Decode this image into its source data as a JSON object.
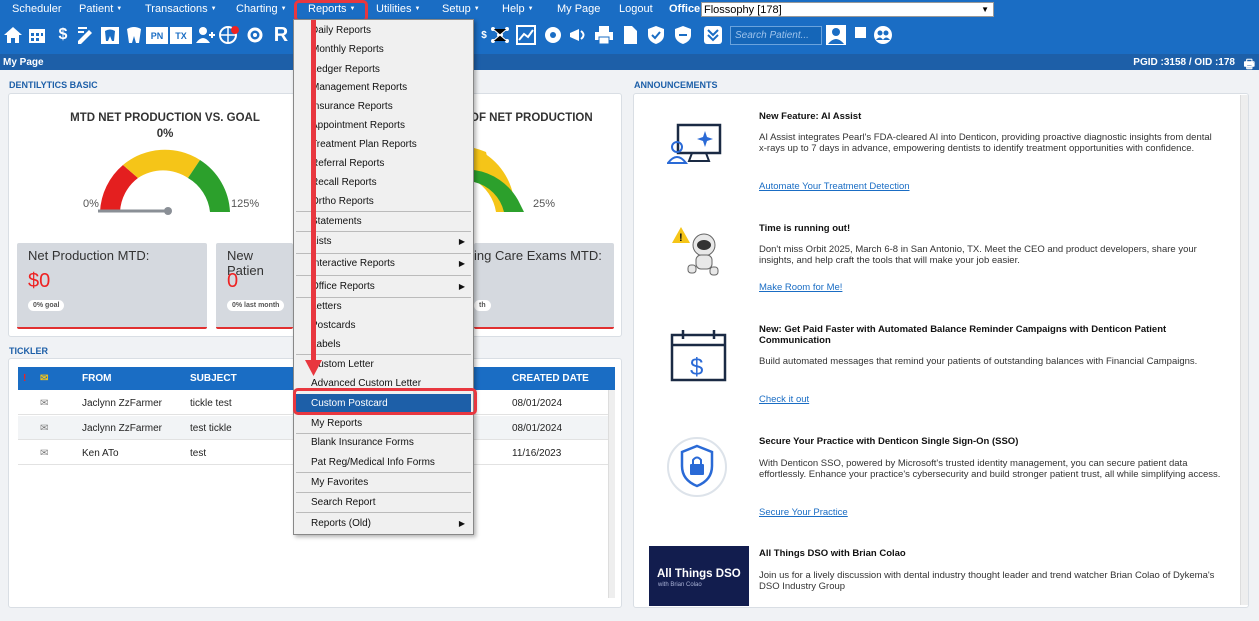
{
  "nav": {
    "items": [
      {
        "label": "Scheduler",
        "caret": false
      },
      {
        "label": "Patient",
        "caret": true
      },
      {
        "label": "Transactions",
        "caret": true
      },
      {
        "label": "Charting",
        "caret": true
      },
      {
        "label": "Reports",
        "caret": true
      },
      {
        "label": "Utilities",
        "caret": true
      },
      {
        "label": "Setup",
        "caret": true
      },
      {
        "label": "Help",
        "caret": true
      },
      {
        "label": "My Page",
        "caret": false
      },
      {
        "label": "Logout",
        "caret": false
      }
    ],
    "office_label": "Office",
    "office_value": "Flossophy [178]"
  },
  "toolbar": {
    "search_placeholder": "Search Patient..."
  },
  "subbar": {
    "title": "My Page",
    "ids": "PGID :3158  /  OID :178"
  },
  "dentilytics": {
    "section_title": "DENTILYTICS BASIC",
    "gauge1": {
      "title": "MTD NET PRODUCTION VS. GOAL",
      "value": "0%",
      "min": "0%",
      "max": "125%"
    },
    "gauge2": {
      "title": "OF NET PRODUCTION",
      "max": "25%"
    },
    "kpis": [
      {
        "title": "Net Production MTD:",
        "value": "$0",
        "badge": "0% goal"
      },
      {
        "title": "New Patien",
        "value": "0",
        "badge": "0% last month"
      },
      {
        "title": "ing Care Exams MTD:",
        "value": "",
        "badge": "th"
      }
    ]
  },
  "tickler": {
    "section_title": "TICKLER",
    "headers": {
      "flag": "!",
      "from": "FROM",
      "subject": "SUBJECT",
      "created": "CREATED DATE"
    },
    "rows": [
      {
        "from": "Jaclynn ZzFarmer",
        "subject": "tickle test",
        "created": "08/01/2024"
      },
      {
        "from": "Jaclynn ZzFarmer",
        "subject": "test tickle",
        "created": "08/01/2024"
      },
      {
        "from": "Ken ATo",
        "subject": "test",
        "created": "11/16/2023"
      }
    ]
  },
  "announcements": {
    "section_title": "ANNOUNCEMENTS",
    "items": [
      {
        "title": "New Feature: AI Assist",
        "body": "AI Assist integrates Pearl's FDA-cleared AI into Denticon, providing proactive diagnostic insights from dental x-rays up to 7 days in advance, empowering dentists to identify treatment opportunities with confidence.",
        "link": "Automate Your Treatment Detection"
      },
      {
        "title": "Time is running out!",
        "body": "Don't miss Orbit 2025, March 6-8 in San Antonio, TX. Meet the CEO and product developers, share your insights, and help craft the tools that will make your job easier.",
        "link": "Make Room for Me!"
      },
      {
        "title": "New: Get Paid Faster with Automated Balance Reminder Campaigns with Denticon Patient Communication",
        "body": "Build automated messages that remind your patients of outstanding balances with Financial Campaigns.",
        "link": "Check it out"
      },
      {
        "title": "Secure Your Practice with Denticon Single Sign-On (SSO)",
        "body": "With Denticon SSO, powered by Microsoft's trusted identity management, you can secure patient data effortlessly. Enhance your practice's cybersecurity and build stronger patient trust, all while simplifying access.",
        "link": "Secure Your Practice"
      },
      {
        "title": "All Things DSO with Brian Colao",
        "body": "Join us for a lively discussion with dental industry thought leader and trend watcher Brian Colao of Dykema's DSO Industry Group",
        "link": ""
      }
    ],
    "dso_thumb": {
      "title": "All Things DSO",
      "sub": "with Brian Colao"
    }
  },
  "reports_menu": {
    "items": [
      {
        "label": "Daily Reports",
        "sub": false
      },
      {
        "label": "Monthly Reports",
        "sub": false
      },
      {
        "label": "Ledger Reports",
        "sub": false
      },
      {
        "label": "Management Reports",
        "sub": false
      },
      {
        "label": "Insurance Reports",
        "sub": false
      },
      {
        "label": "Appointment Reports",
        "sub": false
      },
      {
        "label": "Treatment Plan Reports",
        "sub": false
      },
      {
        "label": "Referral Reports",
        "sub": false
      },
      {
        "label": "Recall Reports",
        "sub": false
      },
      {
        "label": "Ortho Reports",
        "sub": false
      },
      {
        "label": "Statements",
        "sub": false
      },
      {
        "label": "Lists",
        "sub": true
      },
      {
        "label": "Interactive Reports",
        "sub": true
      },
      {
        "label": "Office Reports",
        "sub": true
      },
      {
        "label": "Letters",
        "sub": false
      },
      {
        "label": "Postcards",
        "sub": false
      },
      {
        "label": "Labels",
        "sub": false
      },
      {
        "label": "Custom Letter",
        "sub": false
      },
      {
        "label": "Advanced Custom Letter",
        "sub": false
      },
      {
        "label": "Custom Postcard",
        "sub": false
      },
      {
        "label": "My Reports",
        "sub": false
      },
      {
        "label": "Blank Insurance Forms",
        "sub": false
      },
      {
        "label": "Pat Reg/Medical Info Forms",
        "sub": false
      },
      {
        "label": "My Favorites",
        "sub": false
      },
      {
        "label": "Search Report",
        "sub": false
      },
      {
        "label": "Reports (Old)",
        "sub": true
      }
    ],
    "highlighted": "Custom Postcard"
  },
  "colors": {
    "nav": "#1a6dc4",
    "accent": "#e8373f",
    "highlight": "#1d5fa8"
  }
}
